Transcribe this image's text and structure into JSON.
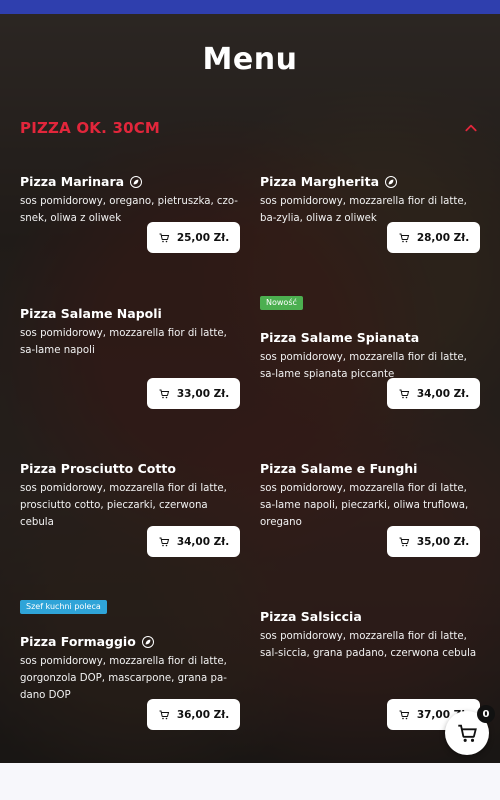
{
  "header": {
    "title": "Menu"
  },
  "section": {
    "title": "PIZZA OK. 30CM",
    "chevron_icon": "chevron-up-icon"
  },
  "items": [
    {
      "name": "Pizza Marinara",
      "icon": "vegan-leaf-icon",
      "desc": "sos pomidorowy, oregano, pietruszka, czo-snek, oliwa z oliwek",
      "price": "25,00 Zł."
    },
    {
      "name": "Pizza Margherita",
      "icon": "vegan-leaf-icon",
      "desc": "sos pomidorowy, mozzarella fior di latte, ba-zylia, oliwa z oliwek",
      "price": "28,00 Zł."
    },
    {
      "name": "Pizza Salame Napoli",
      "desc": "sos pomidorowy, mozzarella fior di latte, sa-lame napoli",
      "price": "33,00 Zł."
    },
    {
      "badge": "Nowość",
      "name": "Pizza Salame Spianata",
      "desc": "sos pomidorowy, mozzarella fior di latte, sa-lame spianata piccante",
      "price": "34,00 Zł."
    },
    {
      "name": "Pizza Prosciutto Cotto",
      "desc": "sos pomidorowy, mozzarella fior di latte, prosciutto cotto, pieczarki, czerwona cebula",
      "price": "34,00 Zł."
    },
    {
      "name": "Pizza Salame e Funghi",
      "desc": "sos pomidorowy, mozzarella fior di latte, sa-lame napoli, pieczarki, oliwa truflowa, oregano",
      "price": "35,00 Zł."
    },
    {
      "badge": "Szef kuchni poleca",
      "name": "Pizza Formaggio",
      "icon": "vegan-leaf-icon",
      "desc": "sos pomidorowy, mozzarella fior di latte, gorgonzola DOP, mascarpone, grana pa-dano DOP",
      "price": "36,00 Zł."
    },
    {
      "name": "Pizza Salsiccia",
      "desc": "sos pomidorowy, mozzarella fior di latte, sal-siccia, grana padano, czerwona cebula",
      "price": "37,00 Zł."
    }
  ],
  "cart": {
    "count": "0",
    "icon": "cart-icon"
  },
  "colors": {
    "topbar": "#2f3fae",
    "accent_red": "#e2263b",
    "badge_new": "#4caf50",
    "badge_chef": "#2fa4d8"
  }
}
